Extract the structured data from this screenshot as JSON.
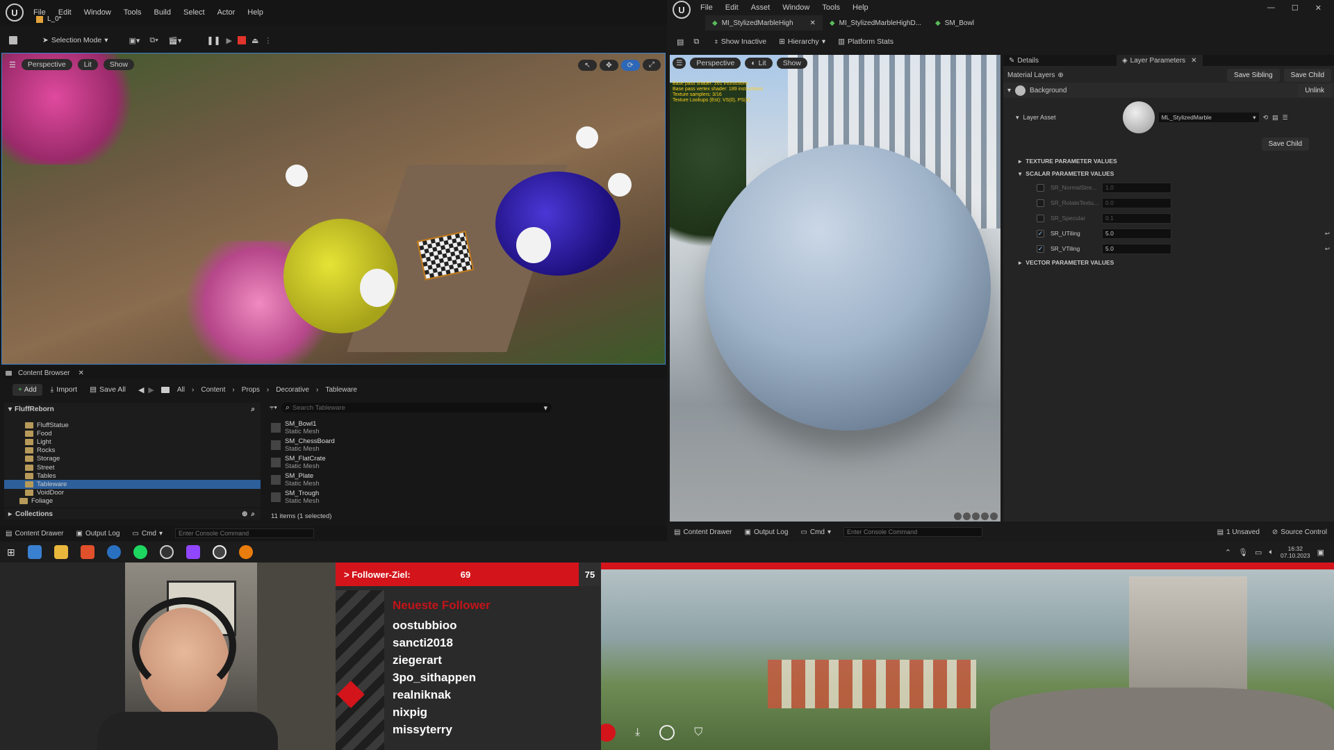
{
  "left_editor": {
    "menu": [
      "File",
      "Edit",
      "Window",
      "Tools",
      "Build",
      "Select",
      "Actor",
      "Help"
    ],
    "level_tab": "L_0*",
    "mode": "Selection Mode",
    "viewport": {
      "perspective": "Perspective",
      "lit": "Lit",
      "show": "Show"
    }
  },
  "content_browser": {
    "tab_title": "Content Browser",
    "add": "Add",
    "import": "Import",
    "save_all": "Save All",
    "breadcrumb": [
      "All",
      "Content",
      "Props",
      "Decorative",
      "Tableware"
    ],
    "root": "FluffReborn",
    "tree": [
      "FluffStatue",
      "Food",
      "Light",
      "Rocks",
      "Storage",
      "Street",
      "Tables",
      "Tableware",
      "VoidDoor",
      "Foliage"
    ],
    "selected_folder": "Tableware",
    "collections": "Collections",
    "search_placeholder": "Search Tableware",
    "assets": [
      {
        "name": "SM_Bowl1",
        "type": "Static Mesh"
      },
      {
        "name": "SM_ChessBoard",
        "type": "Static Mesh"
      },
      {
        "name": "SM_FlatCrate",
        "type": "Static Mesh"
      },
      {
        "name": "SM_Plate",
        "type": "Static Mesh"
      },
      {
        "name": "SM_Trough",
        "type": "Static Mesh"
      }
    ],
    "item_count": "11 items (1 selected)"
  },
  "bottom_bar_left": {
    "content_drawer": "Content Drawer",
    "output_log": "Output Log",
    "cmd": "Cmd",
    "console_placeholder": "Enter Console Command"
  },
  "material_editor": {
    "menu": [
      "File",
      "Edit",
      "Asset",
      "Window",
      "Tools",
      "Help"
    ],
    "tabs": [
      "MI_StylizedMarbleHigh",
      "MI_StylizedMarbleHighD...",
      "SM_Bowl"
    ],
    "toolbar": {
      "show_inactive": "Show Inactive",
      "hierarchy": "Hierarchy",
      "platform_stats": "Platform Stats"
    },
    "viewport": {
      "perspective": "Perspective",
      "lit": "Lit",
      "show": "Show"
    },
    "stats": [
      "Base pass shader: 261 instructions",
      "Base pass vertex shader: 189 instructions",
      "Texture samplers: 3/16",
      "Texture Lookups (Est): VS(0), PS(4)"
    ],
    "panel_tabs": {
      "details": "Details",
      "layer_parameters": "Layer Parameters"
    },
    "material_layers": "Material Layers",
    "save_sibling": "Save Sibling",
    "save_child": "Save Child",
    "background": "Background",
    "unlink": "Unlink",
    "layer_asset_label": "Layer Asset",
    "layer_asset_value": "ML_StylizedMarble",
    "save_child2": "Save Child",
    "sections": {
      "texture": "TEXTURE PARAMETER VALUES",
      "scalar": "SCALAR PARAMETER VALUES",
      "vector": "VECTOR PARAMETER VALUES"
    },
    "scalar_params": [
      {
        "name": "SR_NormalStre...",
        "value": "1.0",
        "enabled": false
      },
      {
        "name": "SR_RotateTextu...",
        "value": "0.0",
        "enabled": false
      },
      {
        "name": "SR_Specular",
        "value": "0.1",
        "enabled": false
      },
      {
        "name": "SR_UTiling",
        "value": "5.0",
        "enabled": true
      },
      {
        "name": "SR_VTiling",
        "value": "5.0",
        "enabled": true
      }
    ],
    "bottom": {
      "content_drawer": "Content Drawer",
      "output_log": "Output Log",
      "cmd": "Cmd",
      "console_placeholder": "Enter Console Command",
      "unsaved": "1 Unsaved",
      "source_control": "Source Control"
    }
  },
  "taskbar": {
    "time": "16:32",
    "date": "07.10.2023"
  },
  "stream_overlay": {
    "goal_label": "> Follower-Ziel:",
    "goal_current": "69",
    "goal_target": "75",
    "newest_title": "Neueste Follower",
    "followers": [
      "oostubbioo",
      "sancti2018",
      "ziegerart",
      "3po_sithappen",
      "realniknak",
      "nixpig",
      "missyterry"
    ]
  },
  "colors": {
    "accent_red": "#e0141e",
    "ue_bg": "#151515",
    "panel": "#242424"
  }
}
